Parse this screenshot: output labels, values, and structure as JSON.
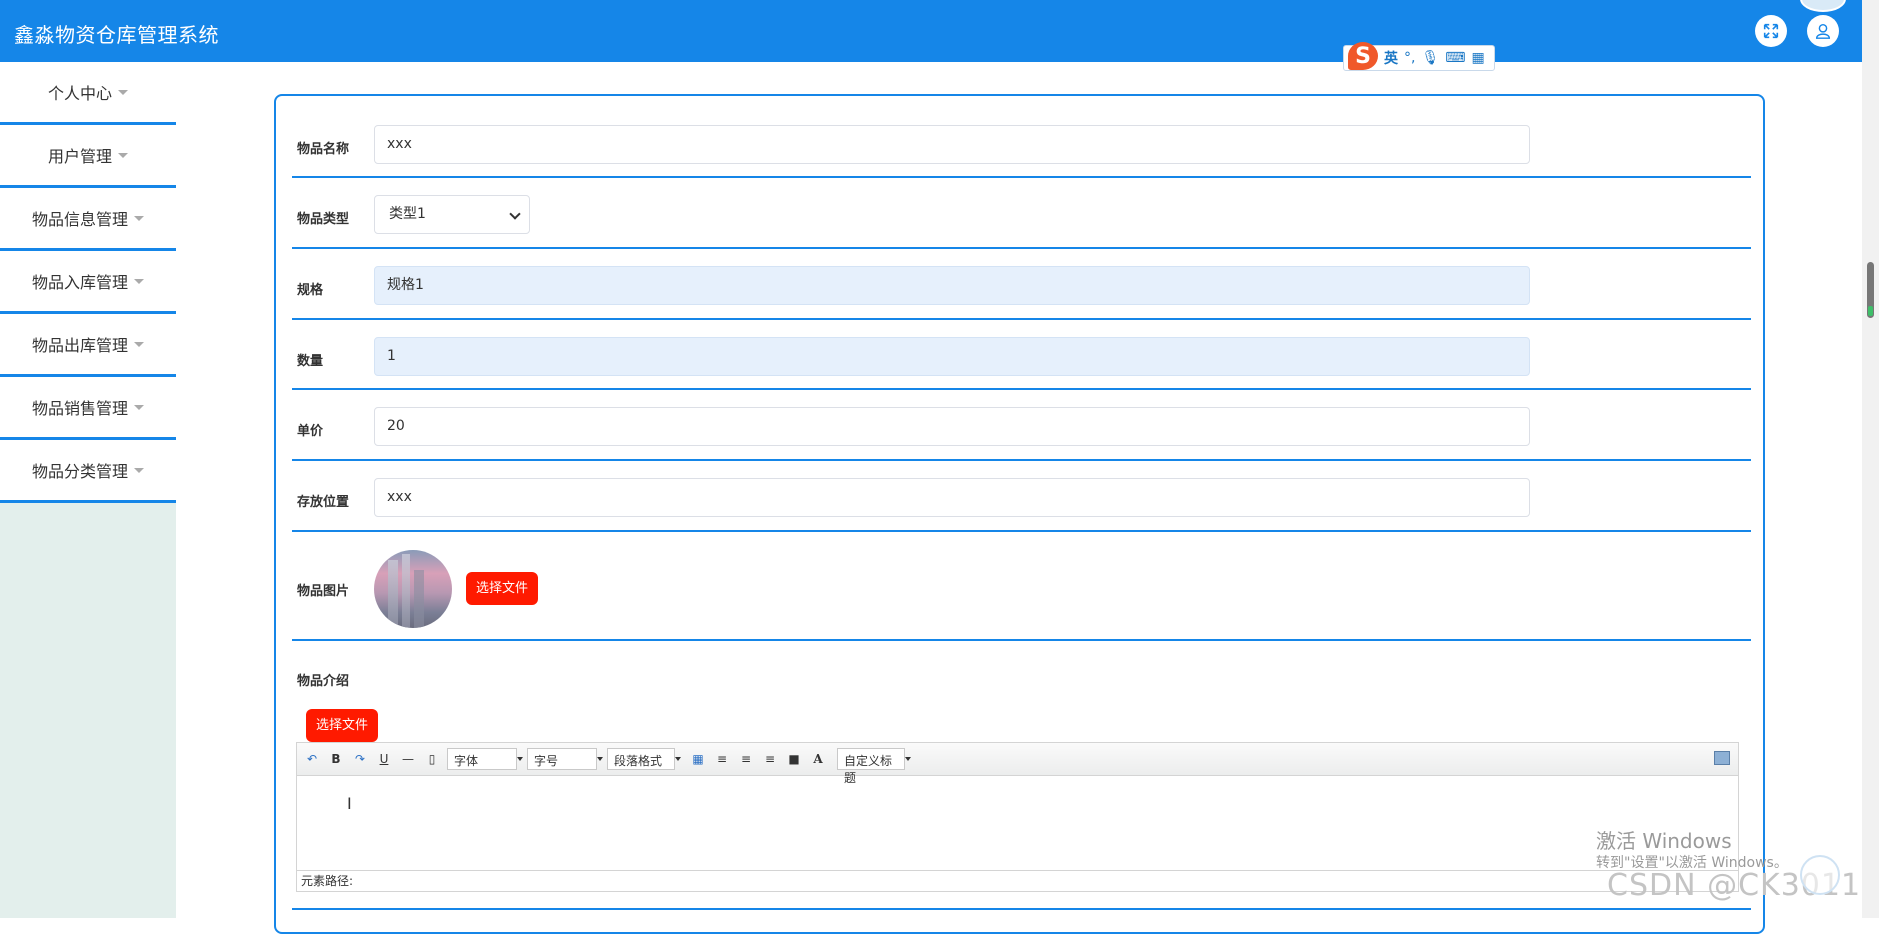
{
  "app": {
    "title": "鑫淼物资仓库管理系统"
  },
  "header": {
    "fullscreen_icon": "expand-icon",
    "user_icon": "user-icon"
  },
  "ime": {
    "mode": "英",
    "glyphs": [
      "°,",
      "mic",
      "keyboard",
      "grid"
    ]
  },
  "sidebar": {
    "items": [
      {
        "label": "个人中心"
      },
      {
        "label": "用户管理"
      },
      {
        "label": "物品信息管理"
      },
      {
        "label": "物品入库管理"
      },
      {
        "label": "物品出库管理"
      },
      {
        "label": "物品销售管理"
      },
      {
        "label": "物品分类管理"
      }
    ]
  },
  "form": {
    "name": {
      "label": "物品名称",
      "value": "xxx"
    },
    "type": {
      "label": "物品类型",
      "value": "类型1"
    },
    "spec": {
      "label": "规格",
      "value": "规格1"
    },
    "qty": {
      "label": "数量",
      "value": "1"
    },
    "price": {
      "label": "单价",
      "value": "20"
    },
    "location": {
      "label": "存放位置",
      "value": "xxx"
    },
    "image": {
      "label": "物品图片",
      "button": "选择文件"
    },
    "intro": {
      "label": "物品介绍",
      "button": "选择文件"
    }
  },
  "editor": {
    "toolbar": {
      "undo": "↶",
      "bold": "B",
      "redo": "↷",
      "underline": "U",
      "hr": "—",
      "font": "字体",
      "size": "字号",
      "paragraph": "段落格式",
      "color": "A",
      "custom": "自定义标题"
    },
    "path_label": "元素路径:"
  },
  "watermark": {
    "line1": "激活 Windows",
    "line2": "转到\"设置\"以激活 Windows。",
    "csdn": "CSDN @CK3011"
  }
}
